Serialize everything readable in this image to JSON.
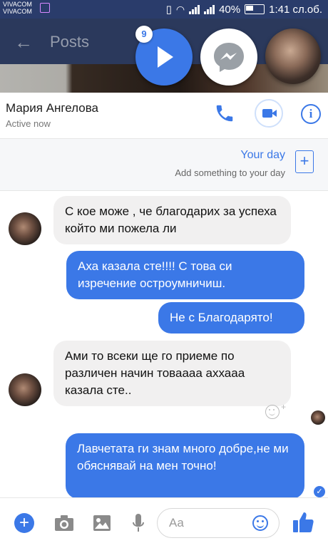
{
  "status_bar": {
    "carrier_1": "VIVACOM",
    "carrier_2": "VIVACOM",
    "battery": "40%",
    "time": "1:41 сл.об."
  },
  "app_bar": {
    "title": "Posts"
  },
  "chat_heads": {
    "unread_badge": "9"
  },
  "conversation": {
    "contact_name": "Мария Ангелова",
    "presence": "Active now"
  },
  "your_day": {
    "title": "Your day",
    "subtitle": "Add something to your day"
  },
  "messages": [
    {
      "direction": "in",
      "text": "С кое може , че благодарих за успеха който ми пожела ли"
    },
    {
      "direction": "out",
      "text": "Аха казала сте!!!! С това си изречение остроумничиш."
    },
    {
      "direction": "out",
      "text": "Не с Благодарято!"
    },
    {
      "direction": "in",
      "text": "Ами то всеки ще го приеме по различен начин товаааа аххааа казала сте.."
    },
    {
      "direction": "out",
      "text": "Лавчетата ги знам много добре,не ми обяснявай на мен точно!"
    }
  ],
  "composer": {
    "placeholder": "Aa"
  },
  "colors": {
    "accent": "#3b78e7",
    "app_bar": "#3a4d7b",
    "incoming_bubble": "#f1f0f0"
  },
  "icons": [
    "back-arrow-icon",
    "play-icon",
    "messenger-icon",
    "phone-icon",
    "video-camera-icon",
    "info-icon",
    "add-story-icon",
    "add-reaction-icon",
    "seen-check-icon",
    "plus-icon",
    "camera-icon",
    "image-icon",
    "microphone-icon",
    "emoji-icon",
    "thumbs-up-icon"
  ]
}
